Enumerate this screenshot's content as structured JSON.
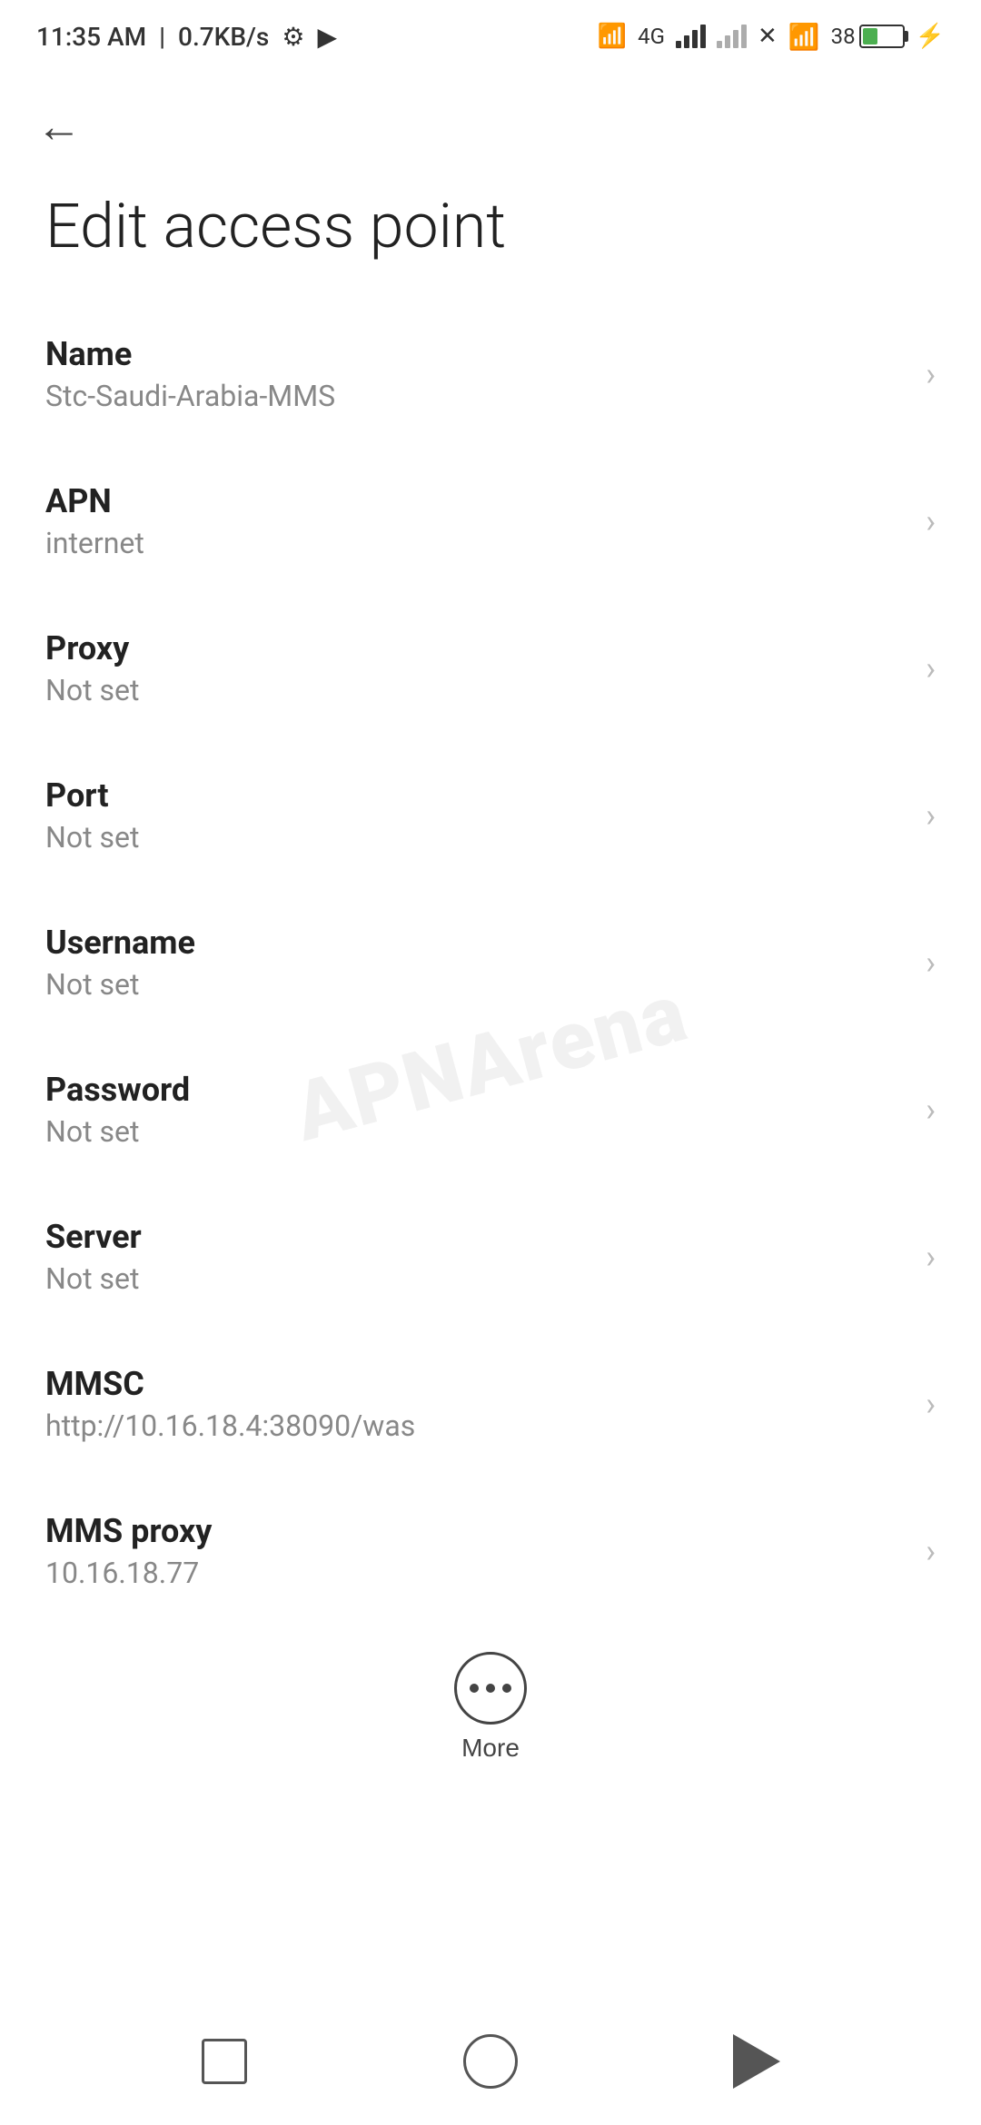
{
  "statusBar": {
    "time": "11:35 AM",
    "speed": "0.7KB/s",
    "battery": "38"
  },
  "header": {
    "backLabel": "←",
    "title": "Edit access point"
  },
  "settings": [
    {
      "id": "name",
      "label": "Name",
      "value": "Stc-Saudi-Arabia-MMS"
    },
    {
      "id": "apn",
      "label": "APN",
      "value": "internet"
    },
    {
      "id": "proxy",
      "label": "Proxy",
      "value": "Not set"
    },
    {
      "id": "port",
      "label": "Port",
      "value": "Not set"
    },
    {
      "id": "username",
      "label": "Username",
      "value": "Not set"
    },
    {
      "id": "password",
      "label": "Password",
      "value": "Not set"
    },
    {
      "id": "server",
      "label": "Server",
      "value": "Not set"
    },
    {
      "id": "mmsc",
      "label": "MMSC",
      "value": "http://10.16.18.4:38090/was"
    },
    {
      "id": "mms-proxy",
      "label": "MMS proxy",
      "value": "10.16.18.77"
    }
  ],
  "more": {
    "label": "More"
  },
  "watermark": {
    "text": "APNArena"
  }
}
